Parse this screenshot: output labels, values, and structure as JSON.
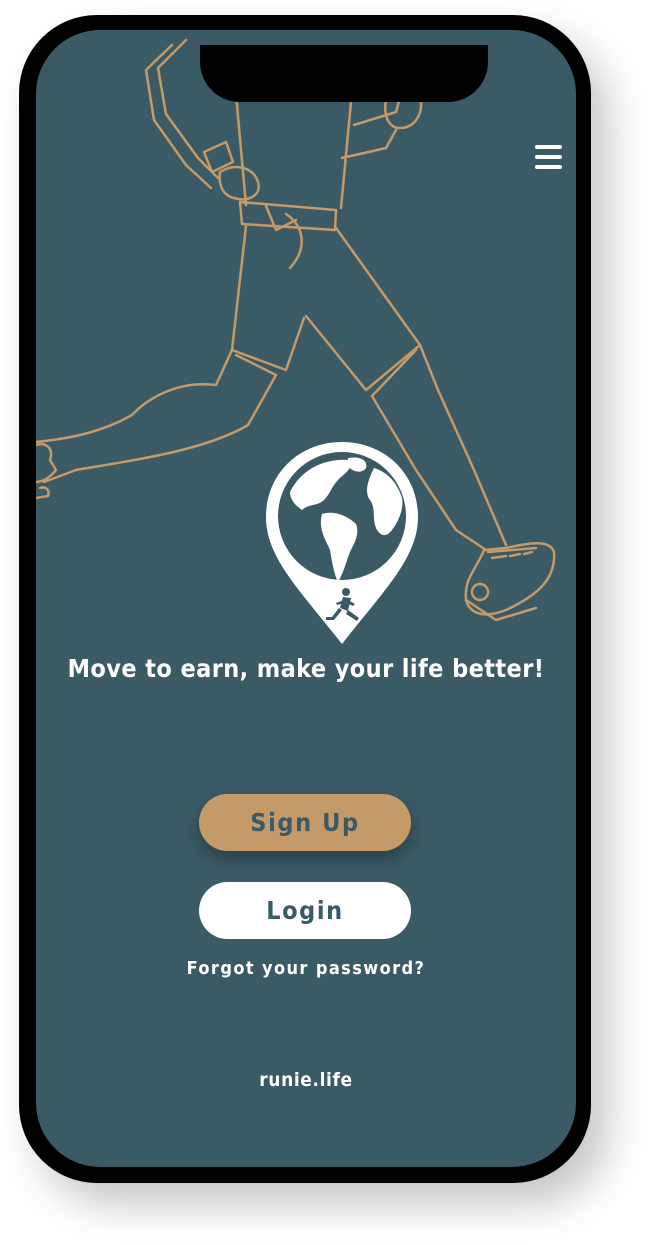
{
  "header": {
    "menu_icon": "hamburger-menu-icon"
  },
  "hero": {
    "illustration": "running-person-line-art",
    "logo": "globe-location-pin-runner-logo",
    "tagline": "Move to earn, make your life better!"
  },
  "actions": {
    "signup_label": "Sign Up",
    "login_label": "Login",
    "forgot_label": "Forgot your password?"
  },
  "footer": {
    "site": "runie.life"
  },
  "colors": {
    "background": "#3a5a66",
    "accent": "#c49a68",
    "text": "#ffffff",
    "button_text": "#3a5a66"
  }
}
